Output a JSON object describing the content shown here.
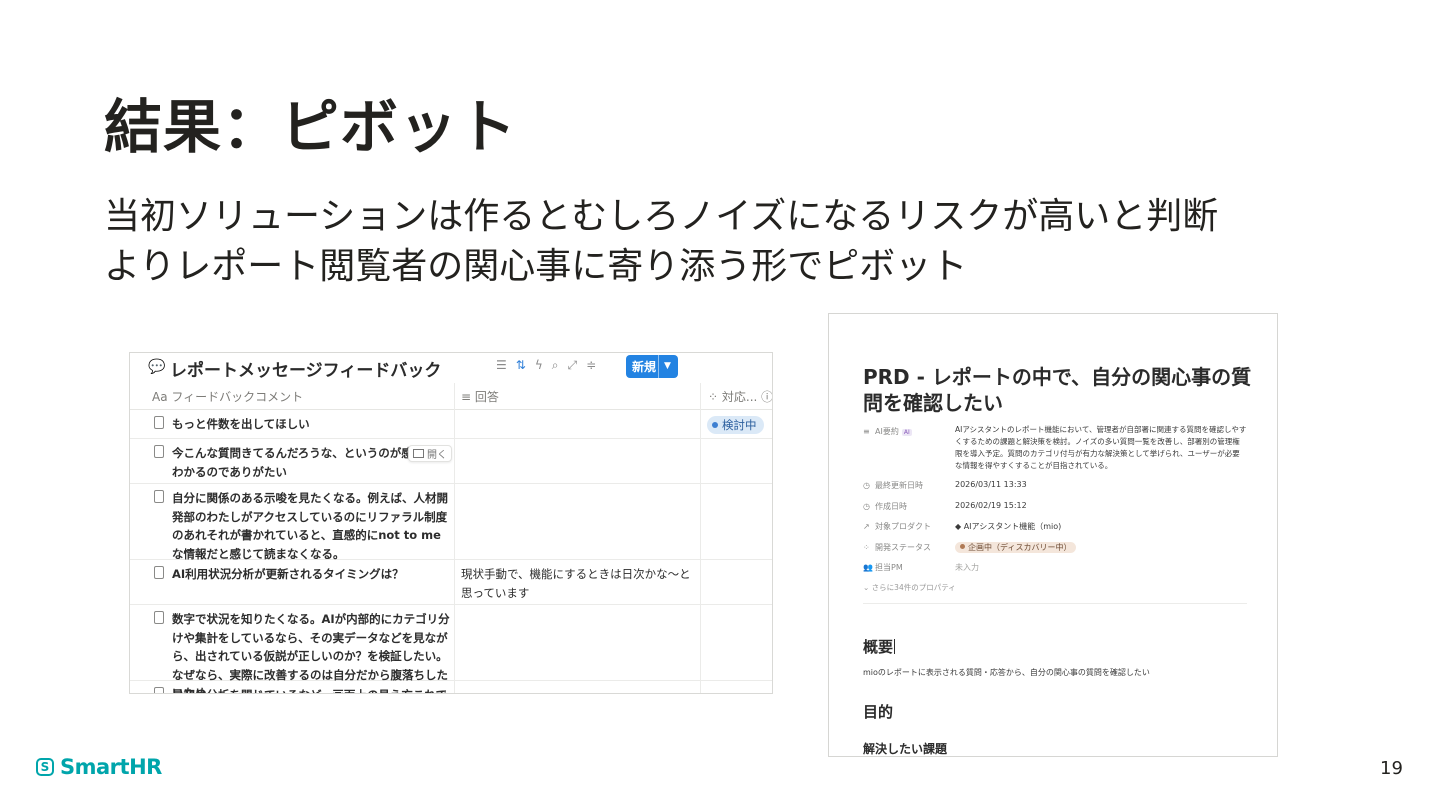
{
  "slide": {
    "title": "結果：ピボット",
    "body": [
      "当初ソリューションは作るとむしろノイズになるリスクが高いと判断",
      "よりレポート閲覧者の関心事に寄り添う形でピボット"
    ],
    "page_number": "19",
    "logo_text": "SmartHR",
    "colors": {
      "brand": "#00a5ab",
      "text": "#23221f",
      "notion_blue": "#2383e2"
    }
  },
  "database": {
    "title_icon": "speech-bubble-icon",
    "title": "レポートメッセージフィードバック",
    "toolbar_icons": [
      "filter-icon",
      "sort-icon",
      "lightning-icon",
      "search-icon",
      "expand-icon",
      "settings-icon"
    ],
    "new_button": "新規",
    "columns": [
      {
        "icon": "Aa",
        "label": "フィードバックコメント"
      },
      {
        "icon": "≡",
        "label": "回答"
      },
      {
        "icon": "⁘",
        "label": "対応..."
      }
    ],
    "open_button": "開く",
    "rows": [
      {
        "feedback": "もっと件数を出してほしい",
        "answer": "",
        "status": "検討中"
      },
      {
        "feedback": "今こんな質問きてるんだろうな、というのが感覚的にわかるのでありがたい",
        "answer": "",
        "status": ""
      },
      {
        "feedback": "自分に関係のある示唆を見たくなる。例えば、人材開発部のわたしがアクセスしているのにリファラル制度のあれそれが書かれていると、直感的にnot to meな情報だと感じて読まなくなる。",
        "answer": "",
        "status": ""
      },
      {
        "feedback": "AI利用状況分析が更新されるタイミングは？",
        "answer": "現状手動で、機能にするときは日次かな〜と思っています",
        "status": ""
      },
      {
        "feedback": "数字で状況を知りたくなる。AIが内部的にカテゴリ分けや集計をしているなら、その実データなどを見ながら、出されている仮説が正しいのか？を検証したい。なぜなら、実際に改善するのは自分だから腹落ちしたいため。",
        "answer": "",
        "status": ""
      },
      {
        "feedback": "最初は分析を閉じているなど、画面上の見え方これでい",
        "answer": "",
        "status": ""
      }
    ]
  },
  "prd": {
    "title": "PRD - レポートの中で、自分の関心事の質問を確認したい",
    "props": [
      {
        "key": "AI要約",
        "icon": "≡",
        "value": ""
      },
      {
        "key": "最終更新日時",
        "icon": "◷",
        "value": "2026/03/11 13:33"
      },
      {
        "key": "作成日時",
        "icon": "◷",
        "value": "2026/02/19 15:12"
      },
      {
        "key": "対象プロダクト",
        "icon": "↗",
        "value": "AIアシスタント機能（mio)"
      },
      {
        "key": "開発ステータス",
        "icon": "⁘",
        "value": "企画中（ディスカバリー中）"
      },
      {
        "key": "担当PM",
        "icon": "👥",
        "value": "未入力"
      }
    ],
    "ai_chip": "AI",
    "summary": "AIアシスタントのレポート機能において、管理者が自部署に関連する質問を確認しやすくするための課題と解決策を検討。ノイズの多い質問一覧を改善し、部署別の管理権限を導入予定。質問のカテゴリ付与が有力な解決策として挙げられ、ユーザーが必要な情報を得やすくすることが目指されている。",
    "more": "さらに34件のプロパティ",
    "overview_heading": "概要",
    "overview_text": "mioのレポートに表示される質問・応答から、自分の関心事の質問を確認したい",
    "goal_heading": "目的",
    "issue_heading": "解決したい課題"
  }
}
